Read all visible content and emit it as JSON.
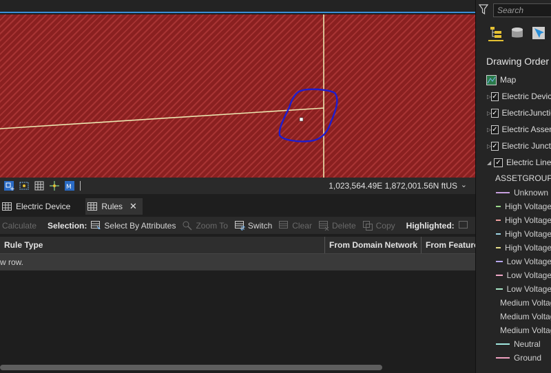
{
  "map": {
    "background": "#8a2020",
    "line_color": "#ece6b0",
    "polygon_color": "#1d1dd0"
  },
  "statusbar": {
    "coordinates": "1,023,564.49E 1,872,001.56N ftUS",
    "chevron": "⌄"
  },
  "tabs": [
    {
      "label": "Electric Device",
      "icon": "table-icon",
      "active": false
    },
    {
      "label": "Rules",
      "icon": "table-icon",
      "active": true,
      "close": "✕"
    }
  ],
  "toolbar": {
    "calculate": "Calculate",
    "selection_label": "Selection:",
    "select_by_attributes": "Select By Attributes",
    "zoom_to": "Zoom To",
    "switch": "Switch",
    "clear": "Clear",
    "delete": "Delete",
    "copy": "Copy",
    "highlighted_label": "Highlighted:"
  },
  "grid": {
    "columns": [
      "Rule Type",
      "From Domain Network",
      "From Feature"
    ],
    "new_row_text": "w row."
  },
  "sidebar": {
    "search_placeholder": "Search",
    "title": "Drawing Order",
    "map_label": "Map",
    "layers": [
      {
        "label": "Electric Device",
        "checked": true,
        "expanded": false
      },
      {
        "label": "ElectricJunction",
        "checked": true,
        "expanded": false
      },
      {
        "label": "Electric Assembly",
        "checked": true,
        "expanded": false
      },
      {
        "label": "Electric Junction",
        "checked": true,
        "expanded": false
      },
      {
        "label": "Electric Line",
        "checked": true,
        "expanded": true
      }
    ],
    "group_field": "ASSETGROUP",
    "legend": [
      {
        "label": "Unknown",
        "color": "#c8a0e0"
      },
      {
        "label": "High Voltage",
        "color": "#9ad98a"
      },
      {
        "label": "High Voltage",
        "color": "#f0a0a0"
      },
      {
        "label": "High Voltage",
        "color": "#9ed8e8"
      },
      {
        "label": "High Voltage",
        "color": "#e8e08a"
      },
      {
        "label": "Low Voltage",
        "color": "#b8a8f0"
      },
      {
        "label": "Low Voltage",
        "color": "#f0a8c8"
      },
      {
        "label": "Low Voltage",
        "color": "#a8e8c8"
      },
      {
        "label": "Medium Voltage",
        "color": "#b0a0f0"
      },
      {
        "label": "Medium Voltage",
        "color": "#e8e0a0"
      },
      {
        "label": "Medium Voltage",
        "color": "#a8d8a0"
      },
      {
        "label": "Neutral",
        "color": "#a0e8e0"
      },
      {
        "label": "Ground",
        "color": "#f0a0c0"
      }
    ]
  }
}
